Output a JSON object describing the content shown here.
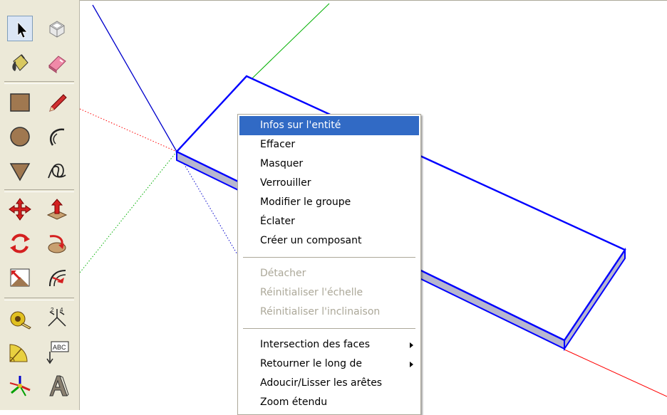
{
  "toolbar": {
    "tools": [
      {
        "name": "select-tool-icon"
      },
      {
        "name": "make-component-tool-icon"
      },
      {
        "name": "paint-bucket-tool-icon"
      },
      {
        "name": "eraser-tool-icon"
      },
      {
        "name": "rectangle-tool-icon"
      },
      {
        "name": "line-tool-icon"
      },
      {
        "name": "circle-tool-icon"
      },
      {
        "name": "arc-tool-icon"
      },
      {
        "name": "polygon-tool-icon"
      },
      {
        "name": "freehand-tool-icon"
      },
      {
        "name": "move-tool-icon"
      },
      {
        "name": "push-pull-tool-icon"
      },
      {
        "name": "rotate-tool-icon"
      },
      {
        "name": "follow-me-tool-icon"
      },
      {
        "name": "scale-tool-icon"
      },
      {
        "name": "offset-tool-icon"
      },
      {
        "name": "tape-measure-tool-icon"
      },
      {
        "name": "dimension-tool-icon"
      },
      {
        "name": "protractor-tool-icon"
      },
      {
        "name": "text-tool-icon",
        "label": "ABC"
      },
      {
        "name": "axes-tool-icon"
      },
      {
        "name": "3d-text-tool-icon"
      }
    ]
  },
  "context_menu": {
    "items": [
      {
        "label": "Infos sur l'entité",
        "highlighted": true
      },
      {
        "label": "Effacer"
      },
      {
        "label": "Masquer"
      },
      {
        "label": "Verrouiller"
      },
      {
        "label": "Modifier le groupe"
      },
      {
        "label": "Éclater"
      },
      {
        "label": "Créer un composant"
      },
      {
        "separator": true
      },
      {
        "label": "Détacher",
        "disabled": true
      },
      {
        "label": "Réinitialiser l'échelle",
        "disabled": true
      },
      {
        "label": "Réinitialiser l'inclinaison",
        "disabled": true
      },
      {
        "separator": true
      },
      {
        "label": "Intersection des faces",
        "submenu": true
      },
      {
        "label": "Retourner le long de",
        "submenu": true
      },
      {
        "label": "Adoucir/Lisser les arêtes"
      },
      {
        "label": "Zoom étendu"
      }
    ]
  },
  "colors": {
    "selection_blue": "#0000ff",
    "axis_red": "#ff0000",
    "axis_green": "#00b000",
    "axis_blue": "#0000cc",
    "menu_highlight": "#316ac5",
    "menu_disabled_text": "#aca899",
    "toolbar_bg": "#ece9d8"
  }
}
